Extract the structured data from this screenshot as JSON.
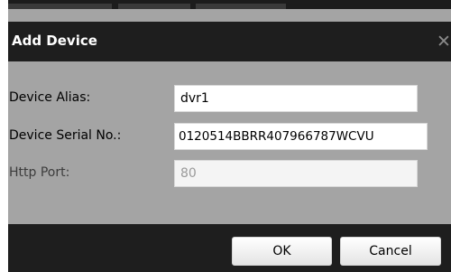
{
  "dialog": {
    "title": "Add Device",
    "close_icon": "close-icon"
  },
  "fields": {
    "alias": {
      "label": "Device Alias:",
      "value": "dvr1"
    },
    "serial": {
      "label": "Device Serial No.:",
      "value": "0120514BBRR407966787WCVU"
    },
    "port": {
      "label": "Http Port:",
      "value": "80"
    }
  },
  "buttons": {
    "ok_label": "OK",
    "cancel_label": "Cancel"
  },
  "colors": {
    "titlebar_bg": "#1e1e1e",
    "dialog_bg": "#a4a4a4",
    "title_text": "#ffffff"
  }
}
